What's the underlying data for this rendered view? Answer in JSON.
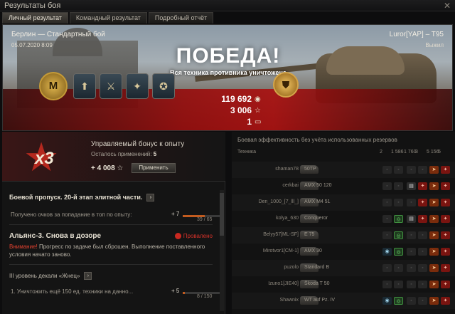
{
  "window": {
    "title": "Результаты боя",
    "close_glyph": "✕"
  },
  "tabs": [
    {
      "label": "Личный результат",
      "active": true
    },
    {
      "label": "Командный результат",
      "active": false
    },
    {
      "label": "Подробный отчёт",
      "active": false
    }
  ],
  "battle": {
    "map_mode": "Берлин — Стандартный бой",
    "datetime": "05.07.2020 8:09",
    "player": "Luror[YAP] – T95",
    "status": "Выжил",
    "result": "ПОБЕДА!",
    "result_sub": "Вся техника противника уничтожена"
  },
  "medals": [
    {
      "name": "mastery-badge-icon",
      "glyph": "M"
    },
    {
      "name": "medal-rank-icon",
      "glyph": "⬆"
    },
    {
      "name": "medal-sword-icon",
      "glyph": "⚔"
    },
    {
      "name": "medal-gun-icon",
      "glyph": "✦"
    },
    {
      "name": "medal-tank-icon",
      "glyph": "✪"
    }
  ],
  "earnings": {
    "credits": "119 692",
    "credits_icon": "◉",
    "xp": "3 006",
    "xp_icon": "☆",
    "tokens": "1",
    "tokens_icon": "▭"
  },
  "bonus": {
    "multiplier": "x3",
    "title": "Управляемый бонус к опыту",
    "remaining_label": "Осталось применений:",
    "remaining_value": "5",
    "xp": "+ 4 008 ☆",
    "apply_label": "Применить"
  },
  "quests": {
    "battle_pass_title": "Боевой пропуск. 20-й этап элитной части.",
    "battle_pass_row_label": "Получено очков за попадание в топ по опыту:",
    "battle_pass_row_value": "+ 7",
    "battle_pass_progress": 0.6,
    "battle_pass_count": "39 / 65",
    "alliance_title": "Альянс-3. Снова в дозоре",
    "alliance_status": "Провалено",
    "warning_prefix": "Внимание!",
    "warning_text": "Прогресс по задаче был сброшен. Выполнение поставленного условия начато заново.",
    "decal_title": "III уровень декали «Жнец»",
    "decal_row_label": "1. Уничтожить ещё 150 ед. техники на данно...",
    "decal_row_value": "+ 5",
    "decal_progress": 0.05,
    "decal_count": "8 / 150"
  },
  "efficiency": {
    "title": "Боевая эффективность без учёта использованных резервов",
    "header_tech": "Техника",
    "columns": [
      "2",
      "1 586",
      "1 760",
      "3",
      "5 156",
      "5"
    ],
    "rows": [
      {
        "player": "shaman78",
        "tank": "50TP",
        "cells": [
          "gray",
          "gray",
          "gray",
          "gray",
          "orange",
          "red"
        ]
      },
      {
        "player": "cerkbai",
        "tank": "AMX 50 120",
        "cells": [
          "gray",
          "gray",
          "white",
          "red",
          "orange",
          "red"
        ]
      },
      {
        "player": "Den_1000_[7_lll_]",
        "tank": "AMX M4 51",
        "cells": [
          "gray",
          "gray",
          "gray",
          "red",
          "orange",
          "red"
        ]
      },
      {
        "player": "kolya_630",
        "tank": "Conqueror",
        "cells": [
          "gray",
          "green",
          "white",
          "red",
          "orange",
          "red"
        ]
      },
      {
        "player": "Belyy57[ML-SF]",
        "tank": "E 75",
        "cells": [
          "gray",
          "green",
          "gray",
          "gray",
          "orange",
          "red"
        ]
      },
      {
        "player": "Mirotvor1[CM-1]",
        "tank": "AMX 30",
        "cells": [
          "blue",
          "green",
          "gray",
          "gray",
          "orange",
          "red"
        ]
      },
      {
        "player": "puzolo",
        "tank": "Standard B",
        "cells": [
          "gray",
          "gray",
          "gray",
          "gray",
          "orange",
          "red"
        ]
      },
      {
        "player": "Izuno1[JIE40]",
        "tank": "Škoda T 50",
        "cells": [
          "gray",
          "gray",
          "gray",
          "gray",
          "orange",
          "red"
        ]
      },
      {
        "player": "Shawnix",
        "tank": "WT auf Pz. IV",
        "cells": [
          "blue",
          "green",
          "gray",
          "gray",
          "orange",
          "red"
        ]
      }
    ]
  }
}
